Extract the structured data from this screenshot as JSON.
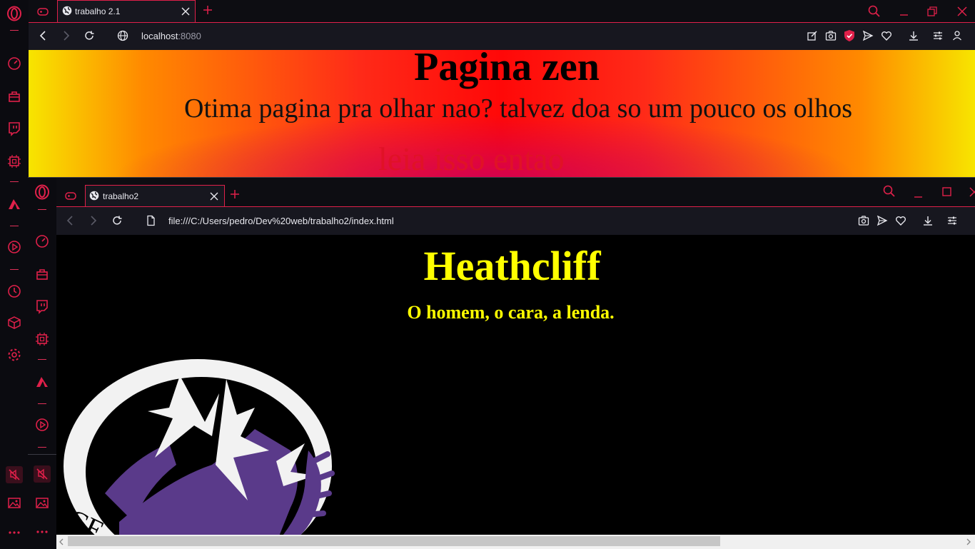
{
  "back_window": {
    "tab_title": "trabalho 2.1",
    "url_host": "localhost",
    "url_port": ":8080",
    "page": {
      "heading": "Pagina zen",
      "subheading": "Otima pagina pra olhar nao? talvez doa so um pouco os olhos",
      "partial_text": "leia isso entao"
    }
  },
  "front_window": {
    "tab_title": "trabalho2",
    "url": "file:///C:/Users/pedro/Dev%20web/trabalho2/index.html",
    "page": {
      "heading": "Heathcliff",
      "subheading": "O homem, o cara, a lenda."
    }
  },
  "icons": {
    "sidebar": [
      "opera-logo-icon",
      "speed-dial-icon",
      "shopping-icon",
      "twitch-icon",
      "extensions-icon",
      "aria-icon",
      "player-icon",
      "history-icon",
      "pinboard-icon",
      "settings-icon",
      "mute-icon",
      "snapshot-icon",
      "more-icon"
    ],
    "toolbar": [
      "back-icon",
      "forward-icon",
      "reload-icon",
      "site-info-icon",
      "edit-icon",
      "camera-icon",
      "adblock-icon",
      "send-icon",
      "heart-icon",
      "download-icon",
      "easy-setup-icon",
      "profile-icon"
    ]
  },
  "colors": {
    "accent": "#e0204a",
    "heathcliff_text": "#ffff00",
    "zen_gradient": [
      "#f7e500",
      "#ff8a00",
      "#ff0808",
      "#cd005a"
    ]
  }
}
